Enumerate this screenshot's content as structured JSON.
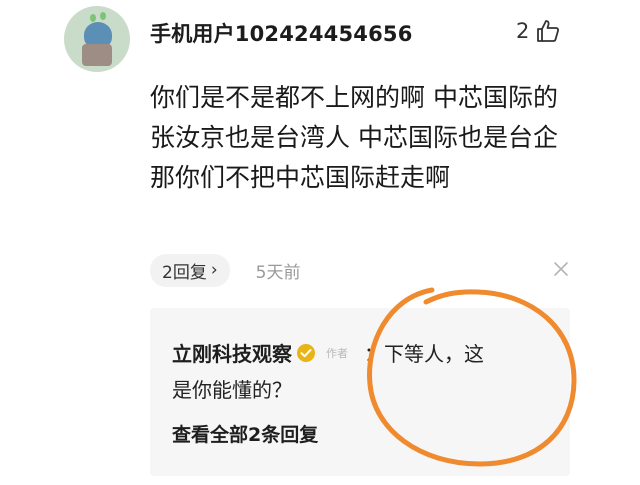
{
  "comment": {
    "username": "手机用户102424454656",
    "likes": "2",
    "text": "你们是不是都不上网的啊 中芯国际的张汝京也是台湾人 中芯国际也是台企 那你们不把中芯国际赶走啊",
    "reply_count_label": "2回复",
    "reply_chevron": "›",
    "time": "5天前"
  },
  "reply": {
    "author": "立刚科技观察",
    "author_tag": "作者",
    "text_line1": "：下等人，这",
    "text_line2": "是你能懂的？",
    "view_all": "查看全部2条回复"
  },
  "icons": {
    "like": "thumbs-up-icon",
    "close": "close-icon",
    "verified": "verified-badge-icon"
  },
  "colors": {
    "annotation": "#f08a2e",
    "verified": "#e8b417"
  }
}
